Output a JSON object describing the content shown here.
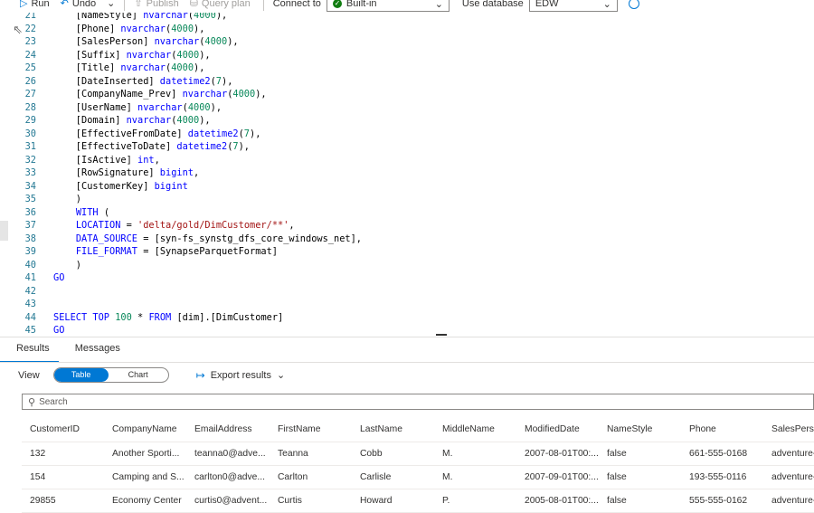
{
  "toolbar": {
    "run": "Run",
    "undo": "Undo",
    "publish": "Publish",
    "query_plan": "Query plan",
    "connect_to": "Connect to",
    "connect_value": "Built-in",
    "use_database": "Use database",
    "database_value": "EDW"
  },
  "editor": {
    "lines": [
      {
        "n": "21",
        "t": "    [NameStyle] nvarchar(4000),"
      },
      {
        "n": "22",
        "t": "    [Phone] nvarchar(4000),"
      },
      {
        "n": "23",
        "t": "    [SalesPerson] nvarchar(4000),"
      },
      {
        "n": "24",
        "t": "    [Suffix] nvarchar(4000),"
      },
      {
        "n": "25",
        "t": "    [Title] nvarchar(4000),"
      },
      {
        "n": "26",
        "t": "    [DateInserted] datetime2(7),"
      },
      {
        "n": "27",
        "t": "    [CompanyName_Prev] nvarchar(4000),"
      },
      {
        "n": "28",
        "t": "    [UserName] nvarchar(4000),"
      },
      {
        "n": "29",
        "t": "    [Domain] nvarchar(4000),"
      },
      {
        "n": "30",
        "t": "    [EffectiveFromDate] datetime2(7),"
      },
      {
        "n": "31",
        "t": "    [EffectiveToDate] datetime2(7),"
      },
      {
        "n": "32",
        "t": "    [IsActive] int,"
      },
      {
        "n": "33",
        "t": "    [RowSignature] bigint,"
      },
      {
        "n": "34",
        "t": "    [CustomerKey] bigint"
      },
      {
        "n": "35",
        "t": "    )"
      },
      {
        "n": "36",
        "t": "    WITH ("
      },
      {
        "n": "37",
        "t": "    LOCATION = 'delta/gold/DimCustomer/**',"
      },
      {
        "n": "38",
        "t": "    DATA_SOURCE = [syn-fs_synstg_dfs_core_windows_net],"
      },
      {
        "n": "39",
        "t": "    FILE_FORMAT = [SynapseParquetFormat]"
      },
      {
        "n": "40",
        "t": "    )"
      },
      {
        "n": "41",
        "t": "GO"
      },
      {
        "n": "42",
        "t": ""
      },
      {
        "n": "43",
        "t": ""
      },
      {
        "n": "44",
        "t": "SELECT TOP 100 * FROM [dim].[DimCustomer]"
      },
      {
        "n": "45",
        "t": "GO"
      }
    ]
  },
  "results": {
    "tab_results": "Results",
    "tab_messages": "Messages",
    "view_label": "View",
    "toggle_table": "Table",
    "toggle_chart": "Chart",
    "export": "Export results",
    "search_placeholder": "Search",
    "columns": [
      "CustomerID",
      "CompanyName",
      "EmailAddress",
      "FirstName",
      "LastName",
      "MiddleName",
      "ModifiedDate",
      "NameStyle",
      "Phone",
      "SalesPerso"
    ],
    "rows": [
      [
        "132",
        "Another Sporti...",
        "teanna0@adve...",
        "Teanna",
        "Cobb",
        "M.",
        "2007-08-01T00:...",
        "false",
        "661-555-0168",
        "adventure-"
      ],
      [
        "154",
        "Camping and S...",
        "carlton0@adve...",
        "Carlton",
        "Carlisle",
        "M.",
        "2007-09-01T00:...",
        "false",
        "193-555-0116",
        "adventure-"
      ],
      [
        "29855",
        "Economy Center",
        "curtis0@advent...",
        "Curtis",
        "Howard",
        "P.",
        "2005-08-01T00:...",
        "false",
        "555-555-0162",
        "adventure-"
      ]
    ]
  },
  "colors": {
    "accent": "#0078d4",
    "keyword": "#0000ff",
    "string": "#a31515",
    "number": "#09885a",
    "line_number": "#237893"
  }
}
